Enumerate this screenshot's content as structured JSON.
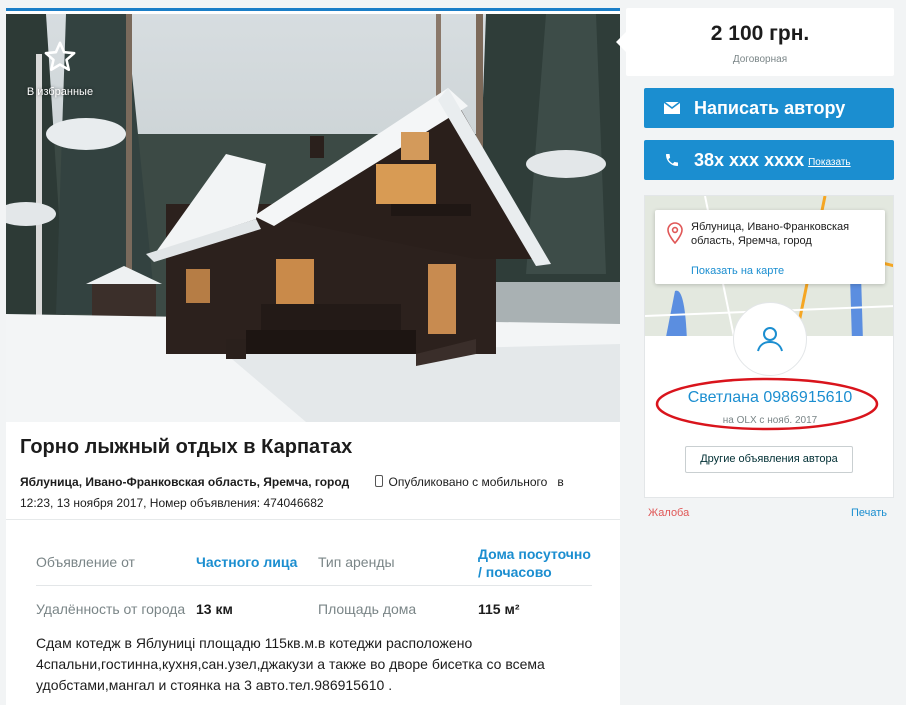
{
  "favorite": {
    "label": "В избранные"
  },
  "listing": {
    "title": "Горно лыжный отдых в Карпатах",
    "location": "Яблуница, Ивано-Франковская область, Яремча, город",
    "published_mobile": "Опубликовано с мобильного",
    "published_prefix": "в",
    "published_rest": "12:23, 13 ноября 2017, Номер объявления: 474046682"
  },
  "params": [
    {
      "label": "Объявление от",
      "value": "Частного лица"
    },
    {
      "label": "Тип аренды",
      "value": "Дома посуточно / почасово"
    },
    {
      "label": "Удалённость от города",
      "value": "13 км"
    },
    {
      "label": "Площадь дома",
      "value": "115 м²"
    }
  ],
  "description": "Сдам котедж в Яблуницi площадю 115кв.м.в котеджи расположено 4спальни,гостинна,кухня,сан.узел,джакузи а также во дворе бисетка со всема удобстами,мангал и стоянка на 3 авто.тел.986915610 .",
  "price": {
    "amount": "2 100 грн.",
    "note": "Договорная"
  },
  "actions": {
    "write_author": "Написать автору",
    "phone": "38x xxx xxxx",
    "show_phone": "Показать"
  },
  "seller": {
    "address": "Яблуница, Ивано-Франковская область, Яремча, город",
    "show_on_map": "Показать на карте",
    "name": "Светлана 0986915610",
    "since": "на OLX с нояб. 2017",
    "other_ads": "Другие объявления автора"
  },
  "footer": {
    "complaint": "Жалоба",
    "print": "Печать"
  },
  "colors": {
    "accent": "#1b8ed0",
    "annotation": "#d9141c",
    "complaint": "#e05757"
  }
}
